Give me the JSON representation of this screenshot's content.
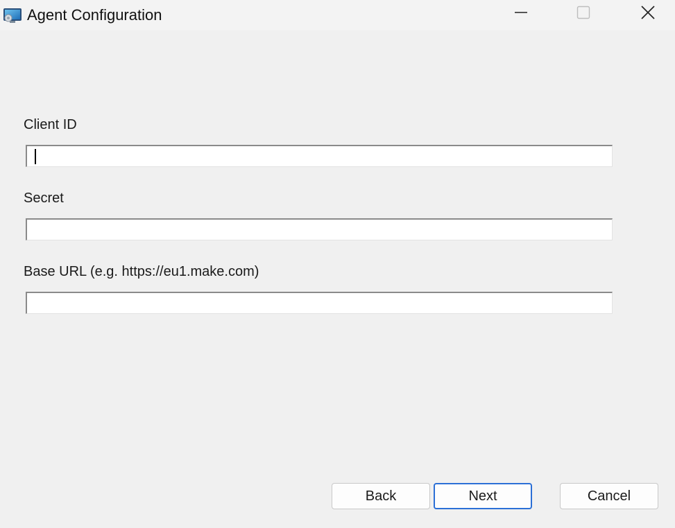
{
  "window": {
    "title": "Agent Configuration",
    "app_icon": "monitor-app-icon",
    "controls": {
      "minimize_icon": "minimize-icon",
      "maximize_icon": "maximize-icon",
      "close_icon": "close-icon"
    }
  },
  "form": {
    "client_id": {
      "label": "Client ID",
      "value": "",
      "placeholder": "",
      "focused": true
    },
    "secret": {
      "label": "Secret",
      "value": "",
      "placeholder": ""
    },
    "base_url": {
      "label": "Base URL (e.g. https://eu1.make.com)",
      "value": "",
      "placeholder": ""
    }
  },
  "footer": {
    "back_label": "Back",
    "next_label": "Next",
    "cancel_label": "Cancel"
  },
  "colors": {
    "background": "#f0f0f0",
    "primary_border": "#2b6fd6"
  }
}
